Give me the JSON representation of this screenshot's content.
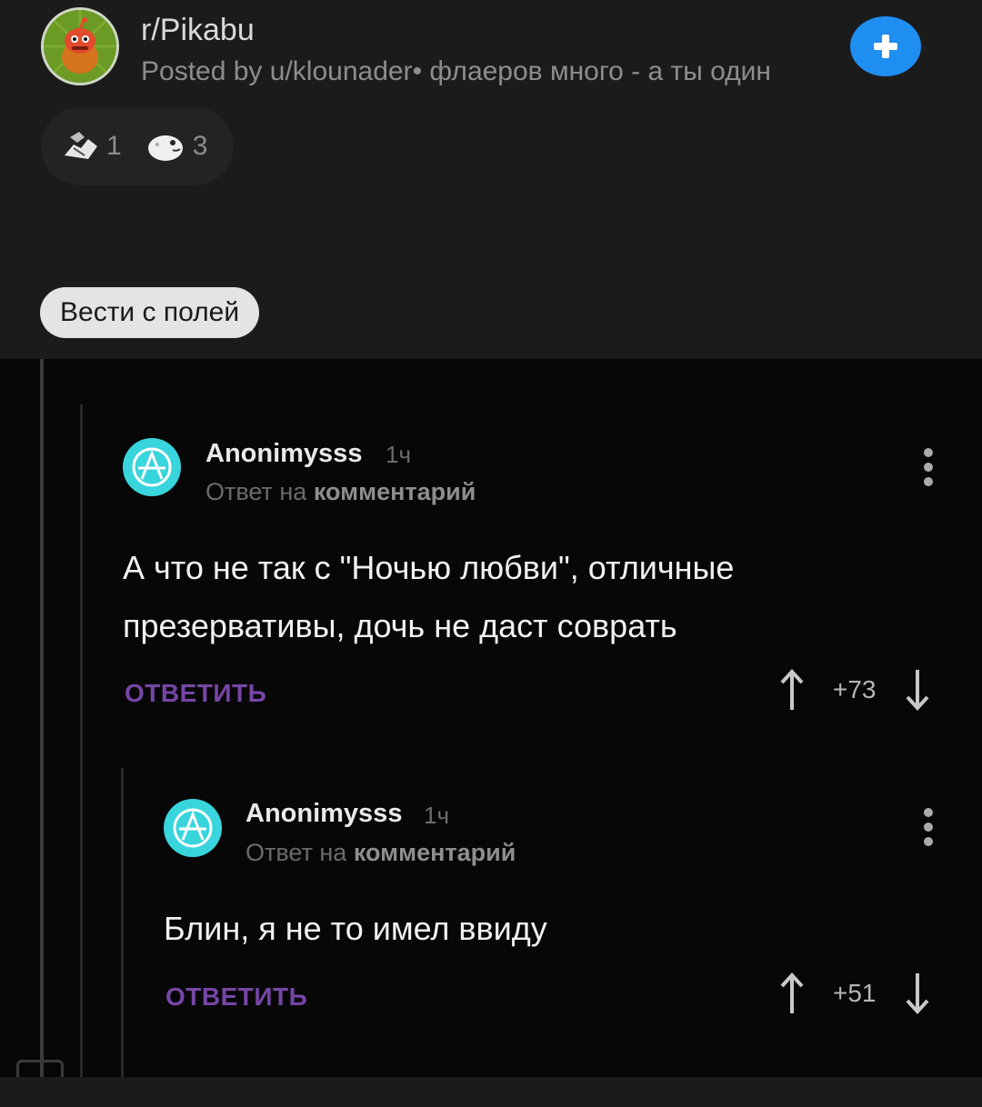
{
  "post": {
    "subreddit": "r/Pikabu",
    "posted_by_prefix": "Posted by ",
    "username": "u/klounader",
    "separator": "•",
    "user_flair": " флаеров много - а ты один",
    "award_1_count": "1",
    "award_2_count": "3",
    "post_flair": "Вести с полей",
    "icons": [
      "subreddit-avatar-icon",
      "plus-icon",
      "handshake-award-icon",
      "seal-award-icon"
    ],
    "join_color": "#1f8ef1"
  },
  "comments": [
    {
      "author": "Anonimysss",
      "time": "1ч",
      "reply_prefix": "Ответ на ",
      "reply_target": "комментарий",
      "text_line1": "А что не так с \"Ночью любви\", отличные",
      "text_line2": "презервативы, дочь не даст соврать",
      "reply_label": "ОТВЕТИТЬ",
      "score": "+73"
    },
    {
      "author": "Anonimysss",
      "time": "1ч",
      "reply_prefix": "Ответ на ",
      "reply_target": "комментарий",
      "text_line1": "Блин, я не то имел ввиду",
      "reply_label": "ОТВЕТИТЬ",
      "score": "+51"
    }
  ],
  "colors": {
    "reply_label": "#7646a6",
    "avatar": "#38d5dc"
  }
}
